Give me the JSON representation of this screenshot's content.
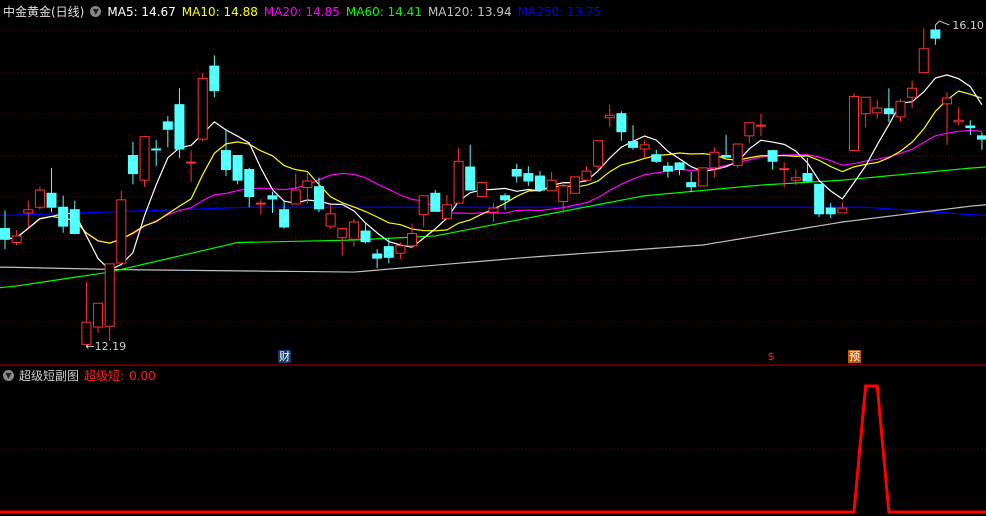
{
  "header": {
    "title": "中金黄金(日线)",
    "ma": [
      {
        "label": "MA5: 14.67",
        "color": "#ffffff"
      },
      {
        "label": "MA10: 14.88",
        "color": "#ffff00"
      },
      {
        "label": "MA20: 14.85",
        "color": "#ff00ff"
      },
      {
        "label": "MA60: 14.41",
        "color": "#00ff00"
      },
      {
        "label": "MA120: 13.94",
        "color": "#c0c0c0"
      },
      {
        "label": "MA250: 13.75",
        "color": "#0000ff"
      }
    ]
  },
  "sub_header": {
    "title": "超级短副图",
    "series_label": "超级短:",
    "series_value": "0.00"
  },
  "markers": [
    {
      "text": "财",
      "index": 24,
      "bg": "#1a3a6a",
      "color": "#ffffff"
    },
    {
      "text": "$",
      "index": 66,
      "bg": "#000000",
      "color": "#ff2020"
    },
    {
      "text": "预",
      "index": 73,
      "bg": "#c05a10",
      "color": "#ffffff"
    }
  ],
  "colors": {
    "up": "#ff3232",
    "down": "#54ffff",
    "grid": "#6a0000",
    "separator": "#b00000",
    "indicator": "#ff0000"
  },
  "chart_data": [
    {
      "type": "candlestick",
      "title": "中金黄金(日线)",
      "ylim": [
        11.97,
        16.405
      ],
      "annotations": [
        {
          "text": "←12.19",
          "index": 7,
          "value": 12.19
        },
        {
          "text": "16.10",
          "index": 80,
          "value": 16.1
        }
      ],
      "ohlc": [
        [
          13.62,
          13.84,
          13.37,
          13.49
        ],
        [
          13.45,
          13.6,
          13.42,
          13.53
        ],
        [
          13.81,
          13.96,
          13.64,
          13.85
        ],
        [
          13.88,
          14.13,
          13.85,
          14.09
        ],
        [
          14.05,
          14.36,
          13.82,
          13.88
        ],
        [
          13.88,
          14.02,
          13.57,
          13.65
        ],
        [
          13.85,
          13.96,
          13.55,
          13.56
        ],
        [
          12.21,
          12.97,
          12.19,
          12.48
        ],
        [
          12.42,
          12.71,
          12.35,
          12.71
        ],
        [
          12.43,
          13.19,
          12.25,
          13.19
        ],
        [
          13.2,
          14.08,
          13.2,
          13.97
        ],
        [
          14.51,
          14.68,
          14.16,
          14.29
        ],
        [
          14.21,
          14.75,
          14.13,
          14.74
        ],
        [
          14.59,
          14.7,
          14.38,
          14.58
        ],
        [
          14.92,
          14.99,
          14.61,
          14.83
        ],
        [
          15.13,
          15.33,
          14.48,
          14.59
        ],
        [
          14.42,
          14.57,
          14.19,
          14.43
        ],
        [
          14.71,
          15.52,
          14.68,
          15.45
        ],
        [
          15.6,
          15.73,
          15.22,
          15.3
        ],
        [
          14.57,
          14.82,
          14.26,
          14.34
        ],
        [
          14.51,
          14.51,
          14.16,
          14.21
        ],
        [
          14.34,
          14.36,
          13.88,
          14.01
        ],
        [
          13.92,
          13.98,
          13.79,
          13.93
        ],
        [
          14.02,
          14.07,
          13.81,
          13.98
        ],
        [
          13.85,
          13.97,
          13.62,
          13.64
        ],
        [
          13.92,
          14.29,
          13.92,
          14.09
        ],
        [
          14.12,
          14.3,
          13.92,
          14.2
        ],
        [
          14.13,
          14.24,
          13.82,
          13.86
        ],
        [
          13.65,
          13.91,
          13.62,
          13.8
        ],
        [
          13.51,
          13.62,
          13.29,
          13.62
        ],
        [
          13.49,
          13.74,
          13.4,
          13.7
        ],
        [
          13.59,
          13.68,
          13.44,
          13.46
        ],
        [
          13.31,
          13.37,
          13.14,
          13.26
        ],
        [
          13.4,
          13.51,
          13.2,
          13.27
        ],
        [
          13.32,
          13.45,
          13.25,
          13.41
        ],
        [
          13.41,
          13.68,
          13.38,
          13.56
        ],
        [
          13.79,
          14.02,
          13.64,
          14.02
        ],
        [
          14.05,
          14.09,
          13.83,
          13.83
        ],
        [
          13.74,
          14.03,
          13.74,
          13.91
        ],
        [
          13.93,
          14.6,
          13.93,
          14.44
        ],
        [
          14.37,
          14.64,
          14.09,
          14.09
        ],
        [
          14.01,
          14.19,
          14.01,
          14.18
        ],
        [
          13.82,
          13.93,
          13.7,
          13.87
        ],
        [
          14.02,
          14.05,
          13.85,
          13.97
        ],
        [
          14.34,
          14.41,
          14.18,
          14.26
        ],
        [
          14.29,
          14.38,
          14.14,
          14.2
        ],
        [
          14.26,
          14.32,
          14.07,
          14.09
        ],
        [
          14.08,
          14.31,
          14.08,
          14.21
        ],
        [
          13.95,
          14.18,
          13.81,
          14.14
        ],
        [
          14.05,
          14.25,
          14.05,
          14.25
        ],
        [
          14.21,
          14.38,
          14.19,
          14.32
        ],
        [
          14.38,
          14.69,
          14.33,
          14.69
        ],
        [
          14.97,
          15.13,
          14.86,
          15.0
        ],
        [
          15.02,
          15.05,
          14.69,
          14.8
        ],
        [
          14.68,
          14.88,
          14.58,
          14.61
        ],
        [
          14.59,
          14.7,
          14.48,
          14.64
        ],
        [
          14.52,
          14.58,
          14.42,
          14.44
        ],
        [
          14.38,
          14.43,
          14.24,
          14.32
        ],
        [
          14.42,
          14.43,
          14.27,
          14.34
        ],
        [
          14.18,
          14.31,
          14.07,
          14.13
        ],
        [
          14.14,
          14.36,
          14.14,
          14.36
        ],
        [
          14.36,
          14.61,
          14.24,
          14.55
        ],
        [
          14.51,
          14.76,
          14.49,
          14.49
        ],
        [
          14.39,
          14.66,
          14.36,
          14.65
        ],
        [
          14.75,
          14.91,
          14.66,
          14.91
        ],
        [
          14.87,
          15.02,
          14.75,
          14.88
        ],
        [
          14.57,
          14.58,
          14.34,
          14.44
        ],
        [
          14.34,
          14.43,
          14.12,
          14.35
        ],
        [
          14.21,
          14.34,
          14.15,
          14.24
        ],
        [
          14.29,
          14.48,
          14.19,
          14.2
        ],
        [
          14.16,
          14.16,
          13.76,
          13.8
        ],
        [
          13.87,
          13.93,
          13.75,
          13.8
        ],
        [
          13.81,
          13.94,
          13.81,
          13.87
        ],
        [
          14.57,
          15.27,
          14.57,
          15.23
        ],
        [
          15.02,
          15.22,
          14.85,
          15.22
        ],
        [
          15.03,
          15.19,
          14.96,
          15.09
        ],
        [
          15.08,
          15.33,
          14.92,
          15.02
        ],
        [
          14.98,
          15.2,
          14.92,
          15.17
        ],
        [
          15.22,
          15.42,
          15.09,
          15.33
        ],
        [
          15.52,
          16.06,
          15.52,
          15.81
        ],
        [
          16.04,
          16.1,
          15.86,
          15.94
        ],
        [
          15.14,
          15.28,
          14.64,
          15.21
        ],
        [
          14.92,
          15.1,
          14.88,
          14.94
        ],
        [
          14.87,
          14.94,
          14.76,
          14.85
        ],
        [
          14.75,
          14.79,
          14.58,
          14.71
        ]
      ],
      "ma_computed": [
        {
          "name": "MA5",
          "period": 5,
          "color": "#ffffff"
        },
        {
          "name": "MA10",
          "period": 10,
          "color": "#ffff00"
        },
        {
          "name": "MA20",
          "period": 20,
          "color": "#ff00ff"
        }
      ],
      "ma_sampled": [
        {
          "name": "MA60",
          "color": "#00ff00",
          "points": [
            [
              0,
              12.9
            ],
            [
              9,
              13.09
            ],
            [
              20,
              13.45
            ],
            [
              30,
              13.48
            ],
            [
              37,
              13.53
            ],
            [
              45,
              13.75
            ],
            [
              55,
              14.02
            ],
            [
              65,
              14.15
            ],
            [
              72,
              14.21
            ],
            [
              84,
              14.37
            ]
          ]
        },
        {
          "name": "MA120",
          "color": "#c0c0c0",
          "points": [
            [
              0,
              13.15
            ],
            [
              10,
              13.12
            ],
            [
              30,
              13.09
            ],
            [
              45,
              13.27
            ],
            [
              60,
              13.42
            ],
            [
              72,
              13.7
            ],
            [
              84,
              13.91
            ]
          ]
        },
        {
          "name": "MA250",
          "color": "#0000ff",
          "points": [
            [
              0,
              13.78
            ],
            [
              21,
              13.88
            ],
            [
              40,
              13.88
            ],
            [
              60,
              13.88
            ],
            [
              74,
              13.88
            ],
            [
              84,
              13.78
            ]
          ]
        }
      ]
    },
    {
      "type": "line",
      "title": "超级短副图",
      "series": [
        {
          "name": "超级短",
          "color": "#ff0000",
          "values": [
            0,
            0,
            0,
            0,
            0,
            0,
            0,
            0,
            0,
            0,
            0,
            0,
            0,
            0,
            0,
            0,
            0,
            0,
            0,
            0,
            0,
            0,
            0,
            0,
            0,
            0,
            0,
            0,
            0,
            0,
            0,
            0,
            0,
            0,
            0,
            0,
            0,
            0,
            0,
            0,
            0,
            0,
            0,
            0,
            0,
            0,
            0,
            0,
            0,
            0,
            0,
            0,
            0,
            0,
            0,
            0,
            0,
            0,
            0,
            0,
            0,
            0,
            0,
            0,
            0,
            0,
            0,
            0,
            0,
            0,
            0,
            0,
            0,
            0,
            1,
            1,
            0,
            0,
            0,
            0,
            0,
            0,
            0,
            0,
            0
          ]
        }
      ],
      "ylim": [
        0,
        1
      ]
    }
  ]
}
